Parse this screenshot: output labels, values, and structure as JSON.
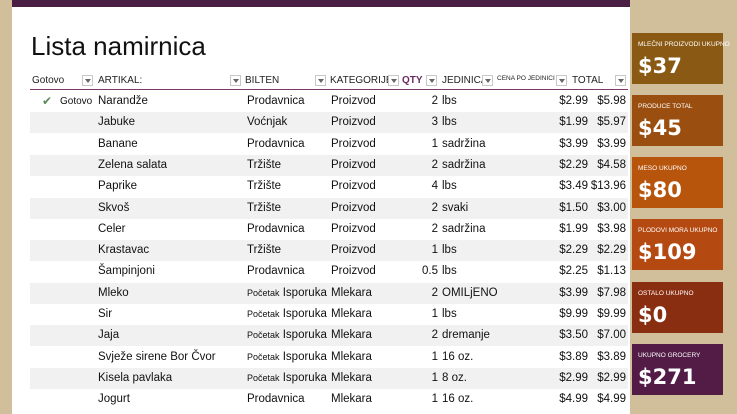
{
  "page_title": "Lista namirnica",
  "columns": {
    "done": "Gotovo",
    "item": "ARTIKAL:",
    "source": "BILTEN",
    "category": "KATEGORIJE",
    "qty": "QTY",
    "unit": "JEDINICA",
    "price": "CENA PO JEDINICI",
    "total": "TOTAL"
  },
  "rows": [
    {
      "done": true,
      "done_label": "Gotovo",
      "item": "Narandže",
      "source": "Prodavnica",
      "category": "Proizvod",
      "qty": "2",
      "unit": "lbs",
      "price": "$2.99",
      "total": "$5.98"
    },
    {
      "done": false,
      "item": "Jabuke",
      "source": "Voćnjak",
      "category": "Proizvod",
      "qty": "3",
      "unit": "lbs",
      "price": "$1.99",
      "total": "$5.97"
    },
    {
      "done": false,
      "item": "Banane",
      "source": "Prodavnica",
      "category": "Proizvod",
      "qty": "1",
      "unit": "sadržina",
      "price": "$3.99",
      "total": "$3.99"
    },
    {
      "done": false,
      "item": "Zelena salata",
      "source": "Tržište",
      "category": "Proizvod",
      "qty": "2",
      "unit": "sadržina",
      "price": "$2.29",
      "total": "$4.58"
    },
    {
      "done": false,
      "item": "Paprike",
      "source": "Tržište",
      "category": "Proizvod",
      "qty": "4",
      "unit": "lbs",
      "price": "$3.49",
      "total": "$13.96"
    },
    {
      "done": false,
      "item": "Skvoš",
      "source": "Tržište",
      "category": "Proizvod",
      "qty": "2",
      "unit": "svaki",
      "price": "$1.50",
      "total": "$3.00"
    },
    {
      "done": false,
      "item": "Celer",
      "source": "Prodavnica",
      "category": "Proizvod",
      "qty": "2",
      "unit": "sadržina",
      "price": "$1.99",
      "total": "$3.98"
    },
    {
      "done": false,
      "item": "Krastavac",
      "source": "Tržište",
      "category": "Proizvod",
      "qty": "1",
      "unit": "lbs",
      "price": "$2.29",
      "total": "$2.29"
    },
    {
      "done": false,
      "item": "Šampinjoni",
      "source": "Prodavnica",
      "category": "Proizvod",
      "qty": "0.5",
      "unit": "lbs",
      "price": "$2.25",
      "total": "$1.13"
    },
    {
      "done": false,
      "item": "Mleko",
      "source_small": "Početak",
      "source": "Isporuka",
      "category": "Mlekara",
      "qty": "2",
      "unit": "OMILjENO",
      "price": "$3.99",
      "total": "$7.98"
    },
    {
      "done": false,
      "item": "Sir",
      "source_small": "Početak",
      "source": "Isporuka",
      "category": "Mlekara",
      "qty": "1",
      "unit": "lbs",
      "price": "$9.99",
      "total": "$9.99"
    },
    {
      "done": false,
      "item": "Jaja",
      "source_small": "Početak",
      "source": "Isporuka",
      "category": "Mlekara",
      "qty": "2",
      "unit": "dremanje",
      "price": "$3.50",
      "total": "$7.00"
    },
    {
      "done": false,
      "item": "Svježe sirene Bor Čvor",
      "source_small": "Početak",
      "source": "Isporuka",
      "category": "Mlekara",
      "qty": "1",
      "unit": "16 oz.",
      "price": "$3.89",
      "total": "$3.89"
    },
    {
      "done": false,
      "item": "Kisela pavlaka",
      "source_small": "Početak",
      "source": "Isporuka",
      "category": "Mlekara",
      "qty": "1",
      "unit": "8 oz.",
      "price": "$2.99",
      "total": "$2.99"
    },
    {
      "done": false,
      "item": "Jogurt",
      "source": "Prodavnica",
      "category": "Mlekara",
      "qty": "1",
      "unit": "16 oz.",
      "price": "$4.99",
      "total": "$4.99"
    }
  ],
  "summary": [
    {
      "label": "MLEČNI PROIZVODI UKUPNO",
      "value": "$37",
      "color": "#8a5a14"
    },
    {
      "label": "PRODUCE TOTAL",
      "value": "$45",
      "color": "#9a4f10"
    },
    {
      "label": "MESO UKUPNO",
      "value": "$80",
      "color": "#b8550d"
    },
    {
      "label": "PLODOVI MORA UKUPNO",
      "value": "$109",
      "color": "#b44a12"
    },
    {
      "label": "OSTALO UKUPNO",
      "value": "$0",
      "color": "#8a2e12"
    },
    {
      "label": "UKUPNO GROCERY",
      "value": "$271",
      "color": "#521c46"
    }
  ]
}
